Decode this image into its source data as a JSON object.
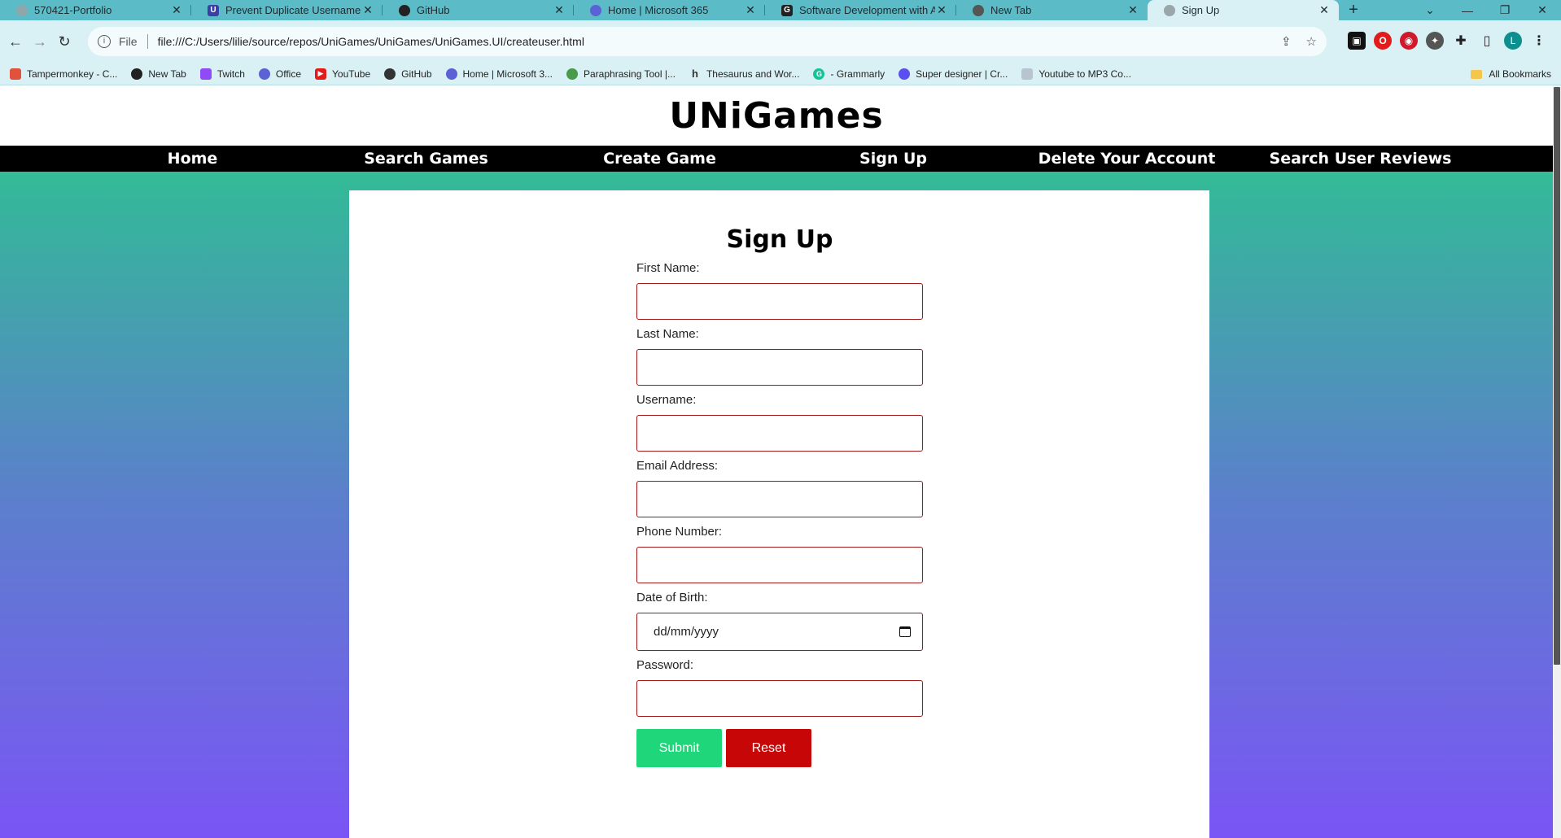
{
  "browser": {
    "tabs": [
      {
        "title": "570421-Portfolio",
        "icon": "globe-icon"
      },
      {
        "title": "Prevent Duplicate Username on",
        "icon": "stackoverflow-icon"
      },
      {
        "title": "GitHub",
        "icon": "github-icon"
      },
      {
        "title": "Home | Microsoft 365",
        "icon": "microsoft365-icon"
      },
      {
        "title": "Software Development with Ag",
        "icon": "google-icon"
      },
      {
        "title": "New Tab",
        "icon": "chrome-icon"
      },
      {
        "title": "Sign Up",
        "icon": "globe-icon",
        "active": true
      }
    ],
    "new_tab_glyph": "+",
    "address": {
      "scheme": "File",
      "url": "file:///C:/Users/lilie/source/repos/UniGames/UniGames/UniGames.UI/createuser.html"
    },
    "profile_initial": "L",
    "bookmarks": [
      {
        "label": "Tampermonkey - C...",
        "icon": "tampermonkey-icon",
        "color": "#e0523b"
      },
      {
        "label": "New Tab",
        "icon": "chrome-icon",
        "color": "#222222"
      },
      {
        "label": "Twitch",
        "icon": "twitch-icon",
        "color": "#8f4bf5"
      },
      {
        "label": "Office",
        "icon": "office-icon",
        "color": "#5a62d6"
      },
      {
        "label": "YouTube",
        "icon": "youtube-icon",
        "color": "#e21b1b"
      },
      {
        "label": "GitHub",
        "icon": "github-icon",
        "color": "#333333"
      },
      {
        "label": "Home | Microsoft 3...",
        "icon": "microsoft365-icon",
        "color": "#5a62d6"
      },
      {
        "label": "Paraphrasing Tool |...",
        "icon": "quillbot-icon",
        "color": "#499b4a"
      },
      {
        "label": "Thesaurus and Wor...",
        "icon": "thesaurus-icon",
        "color": "#333333"
      },
      {
        "label": "- Grammarly",
        "icon": "grammarly-icon",
        "color": "#15c39a"
      },
      {
        "label": "Super designer | Cr...",
        "icon": "superdesigner-icon",
        "color": "#5b4ff0"
      },
      {
        "label": "Youtube to MP3 Co...",
        "icon": "converter-icon",
        "color": "#b8c4d0"
      }
    ],
    "all_bookmarks": "All Bookmarks"
  },
  "site": {
    "title": "UNiGames",
    "nav": [
      "Home",
      "Search Games",
      "Create Game",
      "Sign Up",
      "Delete Your Account",
      "Search User Reviews"
    ]
  },
  "form": {
    "title": "Sign Up",
    "fields": [
      {
        "label": "First Name:",
        "value": ""
      },
      {
        "label": "Last Name:",
        "value": ""
      },
      {
        "label": "Username:",
        "value": ""
      },
      {
        "label": "Email Address:",
        "value": ""
      },
      {
        "label": "Phone Number:",
        "value": ""
      },
      {
        "label": "Date of Birth:",
        "value": "dd/mm/yyyy"
      },
      {
        "label": "Password:",
        "value": ""
      }
    ],
    "submit_label": "Submit",
    "reset_label": "Reset"
  },
  "colors": {
    "submit": "#1fd67a",
    "reset": "#c70707",
    "input_border": "#a11616",
    "gradient_top": "#2fd97c",
    "gradient_bottom": "#7a55f5"
  }
}
